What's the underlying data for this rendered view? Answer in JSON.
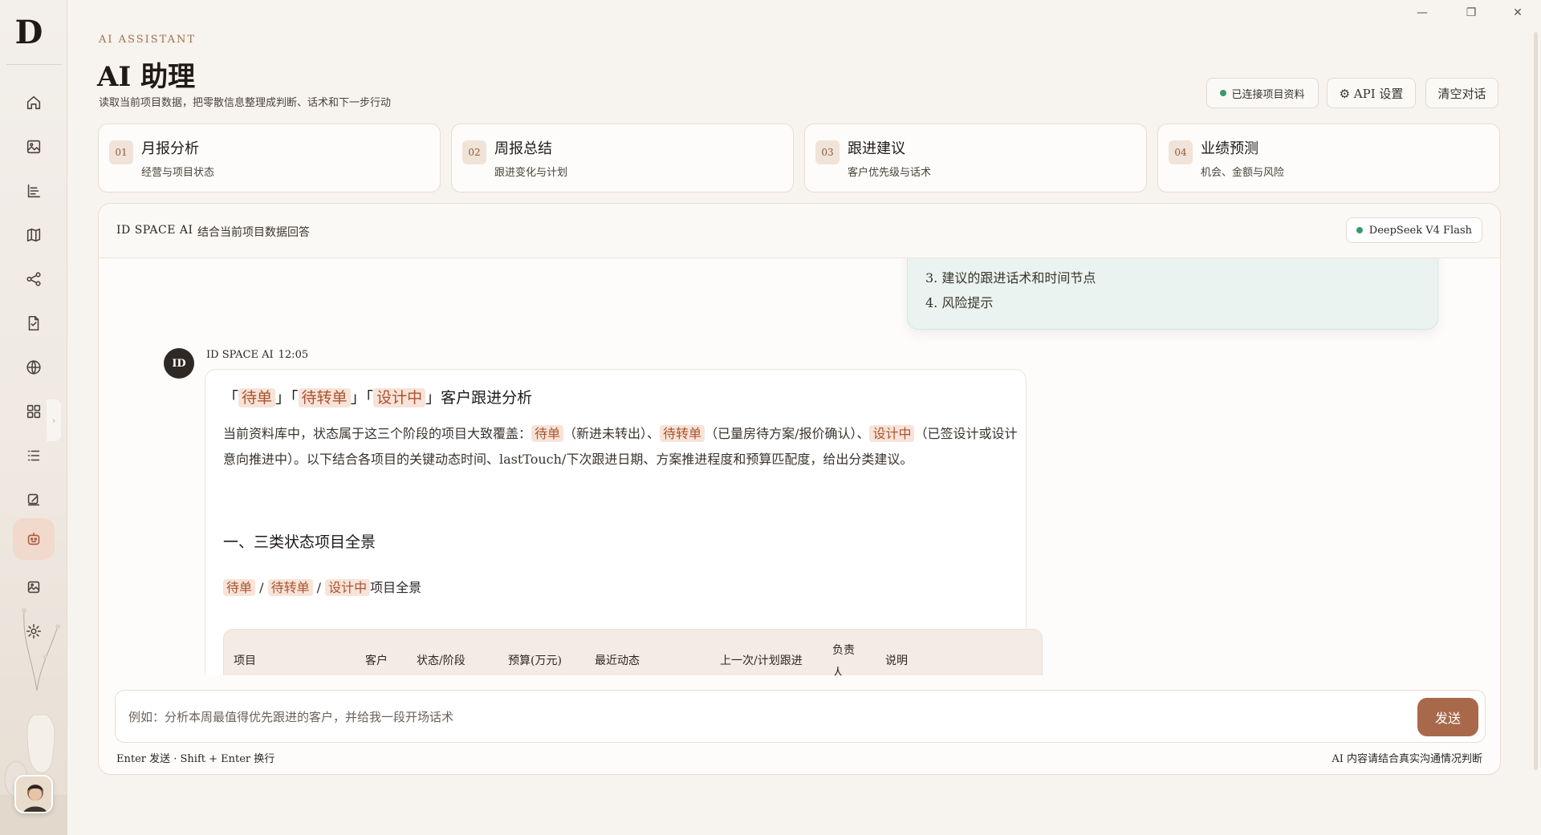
{
  "window": {
    "minimize": "—",
    "maximize": "❐",
    "close": "✕"
  },
  "brand": {
    "logo": "D"
  },
  "header": {
    "eyebrow": "AI ASSISTANT",
    "title": "AI 助理",
    "subtitle": "读取当前项目数据，把零散信息整理成判断、话术和下一步行动",
    "connected_label": "已连接项目资料",
    "api_label": "⚙ API 设置",
    "clear_label": "清空对话"
  },
  "cards": [
    {
      "num": "01",
      "title": "月报分析",
      "sub": "经营与项目状态"
    },
    {
      "num": "02",
      "title": "周报总结",
      "sub": "跟进变化与计划"
    },
    {
      "num": "03",
      "title": "跟进建议",
      "sub": "客户优先级与话术"
    },
    {
      "num": "04",
      "title": "业绩预测",
      "sub": "机会、金额与风险"
    }
  ],
  "chat": {
    "brand": "ID SPACE AI",
    "desc": "结合当前项目数据回答",
    "model": "DeepSeek V4 Flash",
    "user_lines": [
      "3. 建议的跟进话术和时间节点",
      "4. 风险提示"
    ],
    "ai_avatar": "ID",
    "ai_name": "ID SPACE AI",
    "ai_time": "12:05",
    "tags": {
      "a": "待单",
      "b": "待转单",
      "c": "设计中"
    },
    "h1_suffix": "客户跟进分析",
    "para": {
      "p1": "当前资料库中，状态属于这三个阶段的项目大致覆盖：",
      "p2": "（新进未转出）、",
      "p3": "（已量房待方案/报价确认）、",
      "p4": "（已签设计或设计意向推进中）。以下结合各项目的关键动态时间、lastTouch/下次跟进日期、方案推进程度和预算匹配度，给出分类建议。"
    },
    "h2": "一、三类状态项目全景",
    "h3_suffix": "项目全景",
    "table_headers": [
      "项目",
      "客户",
      "状态/阶段",
      "预算(万元)",
      "最近动态",
      "上一次/计划跟进",
      "负责人",
      "说明"
    ]
  },
  "input": {
    "placeholder": "例如：分析本周最值得优先跟进的客户，并给我一段开场话术",
    "send_label": "发送",
    "hint": "Enter 发送 · Shift + Enter 换行",
    "disclaimer": "AI 内容请结合真实沟通情况判断"
  },
  "colors": {
    "accent": "#a8694a",
    "tag_bg": "#f8e3d8",
    "tag_text": "#a9542f",
    "online": "#3b9a6a"
  }
}
